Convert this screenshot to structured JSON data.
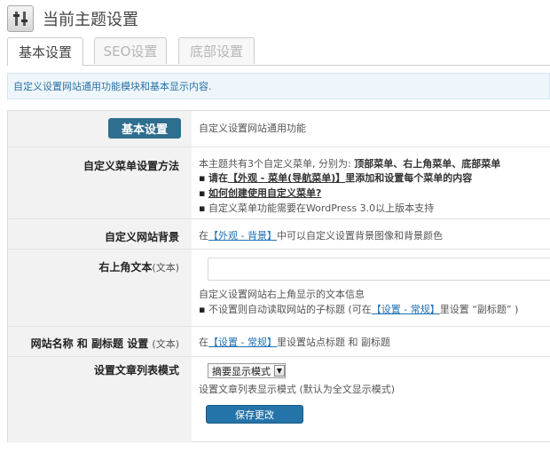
{
  "header": {
    "title": "当前主题设置",
    "icon": "settings-sliders-icon"
  },
  "tabs": [
    {
      "label": "基本设置",
      "active": true
    },
    {
      "label": "SEO设置",
      "active": false
    },
    {
      "label": "底部设置",
      "active": false
    }
  ],
  "notice": "自定义设置网站通用功能模块和基本显示内容.",
  "section": {
    "button_label": "基本设置",
    "description": "自定义设置网站通用功能"
  },
  "menu_row": {
    "label": "自定义菜单设置方法",
    "intro": "本主题共有3个自定义菜单, 分别为: ",
    "intro_menus": "顶部菜单、右上角菜单、底部菜单",
    "b1_pre": "请在",
    "b1_link": "【外观 - 菜单(导航菜单)】",
    "b1_post": "里添加和设置每个菜单的内容",
    "b2_link": "如何创建使用自定义菜单?",
    "b3": "自定义菜单功能需要在WordPress 3.0以上版本支持"
  },
  "background_row": {
    "label": "自定义网站背景",
    "pre": "在",
    "link": "【外观 - 背景】",
    "post": "中可以自定义设置背景图像和背景颜色"
  },
  "topright_row": {
    "label": "右上角文本",
    "label_suffix": "(文本)",
    "input_value": "",
    "help": "自定义设置网站右上角显示的文本信息",
    "bullet_pre": "不设置则自动读取网站的子标题 (可在",
    "bullet_link": "【设置 - 常规】",
    "bullet_post": "里设置 “副标题” )"
  },
  "sitename_row": {
    "label": "网站名称 和 副标题 设置",
    "label_suffix": "(文本)",
    "pre": "在",
    "link": "【设置 - 常规】",
    "post": "里设置站点标题 和 副标题"
  },
  "list_row": {
    "label": "设置文章列表模式",
    "select_value": "摘要显示模式",
    "help": "设置文章列表显示模式 (默认为全文显示模式)"
  },
  "save_label": "保存更改",
  "colors": {
    "accent": "#2271b1",
    "section_button": "#2e6e8e",
    "save_button": "#2574a9"
  }
}
